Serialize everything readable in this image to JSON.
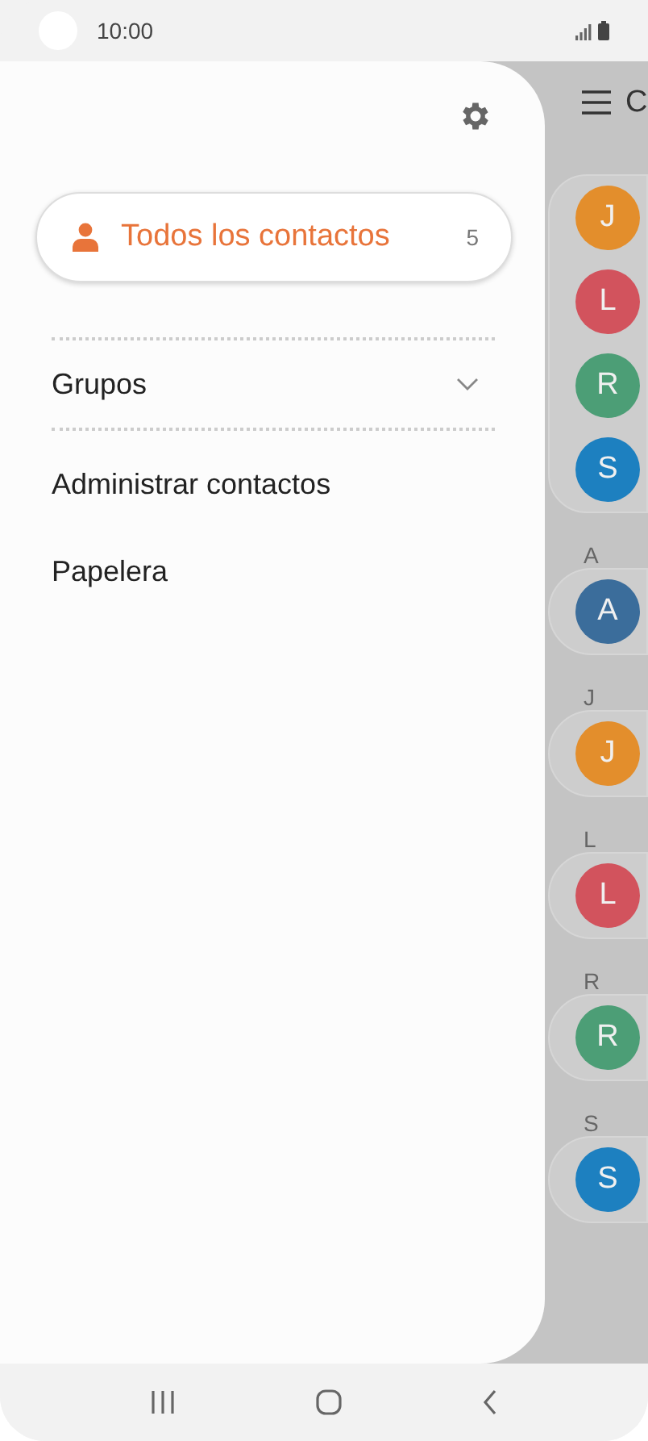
{
  "status_bar": {
    "time": "10:00"
  },
  "drawer": {
    "all_contacts": {
      "label": "Todos los contactos",
      "count": "5",
      "selected": true
    },
    "menu": [
      {
        "label": "Grupos",
        "kind": "expandable",
        "expanded": false
      },
      {
        "label": "Administrar contactos",
        "kind": "link"
      },
      {
        "label": "Papelera",
        "kind": "link"
      }
    ]
  },
  "contacts_screen": {
    "title": "C",
    "favorites": [
      {
        "initial": "J",
        "color": "#e38e2c"
      },
      {
        "initial": "L",
        "color": "#d2535d"
      },
      {
        "initial": "R",
        "color": "#4c9e76"
      },
      {
        "initial": "S",
        "color": "#1d80c0"
      }
    ],
    "sections": [
      {
        "letter": "A",
        "contacts": [
          {
            "initial": "A",
            "color": "#3b6d9b"
          }
        ]
      },
      {
        "letter": "J",
        "contacts": [
          {
            "initial": "J",
            "color": "#e38e2c"
          }
        ]
      },
      {
        "letter": "L",
        "contacts": [
          {
            "initial": "L",
            "color": "#d2535d"
          }
        ]
      },
      {
        "letter": "R",
        "contacts": [
          {
            "initial": "R",
            "color": "#4c9e76"
          }
        ]
      },
      {
        "letter": "S",
        "contacts": [
          {
            "initial": "S",
            "color": "#1d80c0"
          }
        ]
      }
    ]
  }
}
